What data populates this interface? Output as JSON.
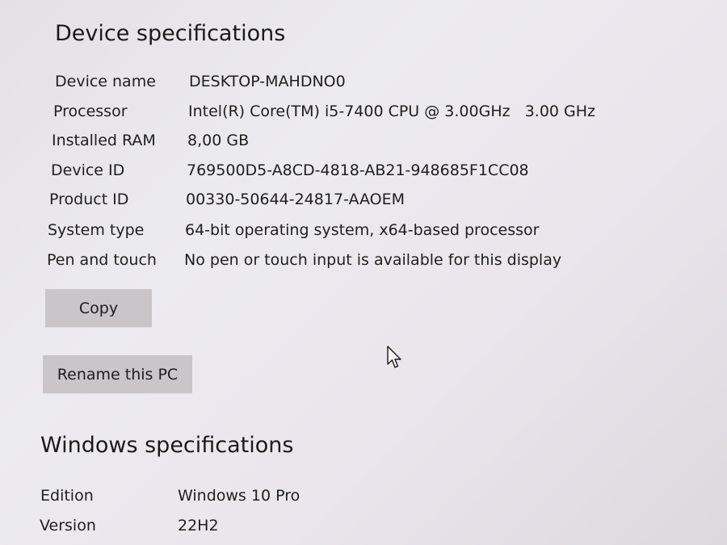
{
  "device_section": {
    "title": "Device specifications",
    "rows": [
      {
        "label": "Device name",
        "value": "DESKTOP-MAHDNO0"
      },
      {
        "label": "Processor",
        "value": "Intel(R) Core(TM) i5-7400 CPU @ 3.00GHz   3.00 GHz"
      },
      {
        "label": "Installed RAM",
        "value": "8,00 GB"
      },
      {
        "label": "Device ID",
        "value": "769500D5-A8CD-4818-AB21-948685F1CC08"
      },
      {
        "label": "Product ID",
        "value": "00330-50644-24817-AAOEM"
      },
      {
        "label": "System type",
        "value": "64-bit operating system, x64-based processor"
      },
      {
        "label": "Pen and touch",
        "value": "No pen or touch input is available for this display"
      }
    ],
    "copy_button": "Copy",
    "rename_button": "Rename this PC"
  },
  "windows_section": {
    "title": "Windows specifications",
    "rows": [
      {
        "label": "Edition",
        "value": "Windows 10 Pro"
      },
      {
        "label": "Version",
        "value": "22H2"
      }
    ]
  },
  "icons": {
    "cursor": "mouse-pointer-icon"
  }
}
